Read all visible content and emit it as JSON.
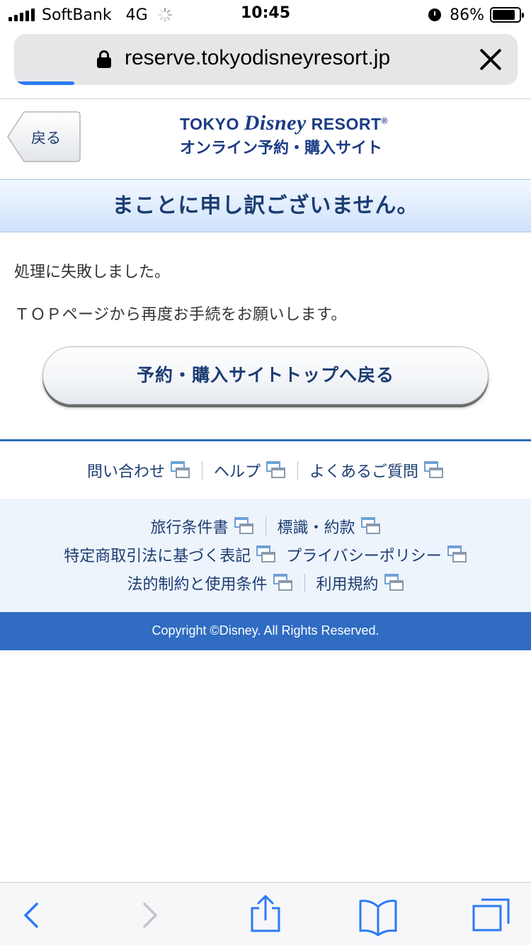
{
  "status_bar": {
    "carrier": "SoftBank",
    "network": "4G",
    "time": "10:45",
    "battery_percent": "86%",
    "battery_level": 0.86
  },
  "browser": {
    "url": "reserve.tokyodisneyresort.jp",
    "load_progress": 0.12,
    "accent_color": "#2c7af6"
  },
  "header": {
    "back_label": "戻る",
    "logo_line1_a": "TOKYO ",
    "logo_line1_b": "Disney",
    "logo_line1_c": " RESORT",
    "logo_reg": "®",
    "logo_line2": "オンライン予約・購入サイト"
  },
  "error": {
    "title": "まことに申し訳ございません。",
    "message1": "処理に失敗しました。",
    "message2": "ＴＯＰページから再度お手続をお願いします。",
    "button_label": "予約・購入サイトトップへ戻る"
  },
  "links_primary": [
    {
      "label": "問い合わせ"
    },
    {
      "label": "ヘルプ"
    },
    {
      "label": "よくあるご質問"
    }
  ],
  "footer_links": {
    "row1": [
      {
        "label": "旅行条件書"
      },
      {
        "label": "標識・約款"
      }
    ],
    "row2": [
      {
        "label": "特定商取引法に基づく表記"
      },
      {
        "label": "プライバシーポリシー"
      }
    ],
    "row3": [
      {
        "label": "法的制約と使用条件"
      },
      {
        "label": "利用規約"
      }
    ]
  },
  "copyright": "Copyright ©Disney. All Rights Reserved.",
  "toolbar": {
    "icons": [
      "back-arrow-icon",
      "forward-arrow-icon",
      "share-icon",
      "bookmarks-icon",
      "tabs-icon"
    ]
  },
  "colors": {
    "brand_navy": "#1b3b84",
    "link_text": "#1c3d72",
    "footer_blue": "#2f6cc2",
    "banner_light": "#cfe2fb"
  }
}
